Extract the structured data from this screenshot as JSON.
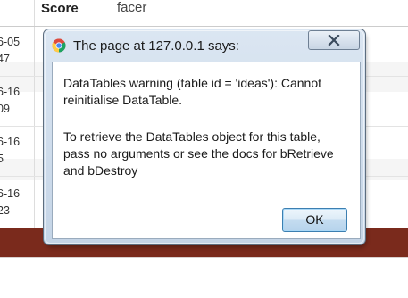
{
  "table": {
    "headers": {
      "score": "Score",
      "facer": "facer"
    },
    "rows": [
      {
        "line1": "6-05",
        "line2": "47"
      },
      {
        "line1": "6-16",
        "line2": "09"
      },
      {
        "line1": "6-16",
        "line2": "5"
      },
      {
        "line1": "6-16",
        "line2": "23"
      }
    ]
  },
  "dialog": {
    "title": "The page at 127.0.0.1 says:",
    "message_lines": [
      "DataTables warning (table id = 'ideas'): Cannot",
      "reinitialise DataTable.",
      "To retrieve the DataTables object for this table,",
      "pass no arguments or see the docs for bRetrieve",
      "and bDestroy"
    ],
    "ok_label": "OK",
    "close_icon": "close-icon",
    "app_icon": "chrome-icon"
  },
  "colors": {
    "footer": "#7a2a1c",
    "dialog_frame": "#c4d4e6",
    "ok_border": "#3c7fb1"
  }
}
